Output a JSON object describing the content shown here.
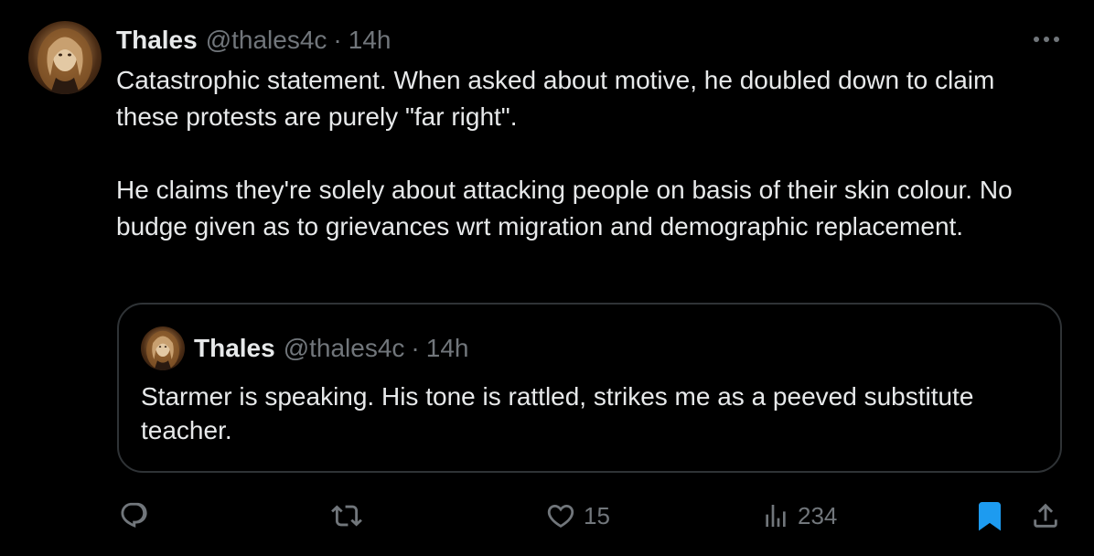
{
  "tweet": {
    "author_name": "Thales",
    "handle": "@thales4c",
    "separator": "·",
    "time": "14h",
    "paragraphs": [
      "Catastrophic statement. When asked about motive, he doubled down to claim these protests are purely \"far right\".",
      "He claims they're solely about attacking people on basis of their skin colour. No budge given as to grievances wrt migration and demographic replacement."
    ]
  },
  "quoted": {
    "author_name": "Thales",
    "handle": "@thales4c",
    "separator": "·",
    "time": "14h",
    "text": "Starmer is speaking. His tone is rattled, strikes me as a peeved substitute teacher."
  },
  "actions": {
    "replies": {
      "icon": "reply-icon",
      "count": ""
    },
    "retweets": {
      "icon": "retweet-icon",
      "count": ""
    },
    "likes": {
      "icon": "heart-icon",
      "count": "15"
    },
    "views": {
      "icon": "views-icon",
      "count": "234"
    },
    "bookmark": {
      "icon": "bookmark-icon",
      "active": true
    },
    "share": {
      "icon": "share-icon"
    }
  },
  "colors": {
    "background": "#000000",
    "text": "#e7e9ea",
    "secondary": "#71767b",
    "border": "#2f3336",
    "accent": "#1d9bf0"
  }
}
